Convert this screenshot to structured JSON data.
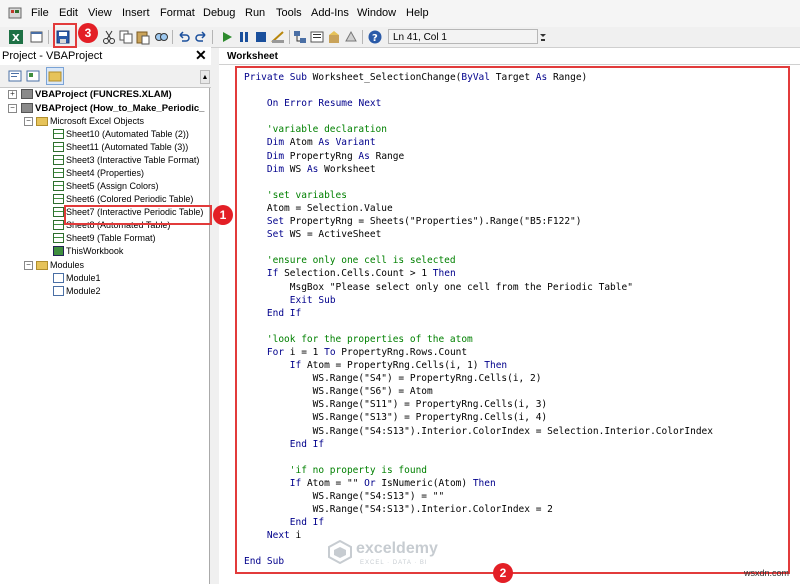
{
  "menubar": {
    "items": [
      "File",
      "Edit",
      "View",
      "Insert",
      "Format",
      "Debug",
      "Run",
      "Tools",
      "Add-Ins",
      "Window",
      "Help"
    ]
  },
  "toolbar": {
    "position": "Ln 41, Col 1",
    "icons": [
      "excel-icon",
      "insert-userform-icon",
      "save-icon",
      "cut-icon",
      "copy-icon",
      "paste-icon",
      "find-icon",
      "undo-icon",
      "redo-icon",
      "run-icon",
      "break-icon",
      "reset-icon",
      "design-mode-icon",
      "project-explorer-icon",
      "properties-icon",
      "object-browser-icon",
      "toolbox-icon",
      "help-icon"
    ]
  },
  "project_pane": {
    "title": "Project - VBAProject",
    "tree": [
      {
        "label": "VBAProject (FUNCRES.XLAM)",
        "kind": "project",
        "level": 0
      },
      {
        "label": "VBAProject (How_to_Make_Periodic_",
        "kind": "project",
        "level": 0
      },
      {
        "label": "Microsoft Excel Objects",
        "kind": "folder",
        "level": 1
      },
      {
        "label": "Sheet10 (Automated Table (2))",
        "kind": "sheet",
        "level": 2
      },
      {
        "label": "Sheet11 (Automated Table (3))",
        "kind": "sheet",
        "level": 2
      },
      {
        "label": "Sheet3 (Interactive Table Format)",
        "kind": "sheet",
        "level": 2
      },
      {
        "label": "Sheet4 (Properties)",
        "kind": "sheet",
        "level": 2
      },
      {
        "label": "Sheet5 (Assign Colors)",
        "kind": "sheet",
        "level": 2
      },
      {
        "label": "Sheet6 (Colored Periodic Table)",
        "kind": "sheet",
        "level": 2
      },
      {
        "label": "Sheet7 (Interactive Periodic Table)",
        "kind": "sheet",
        "level": 2
      },
      {
        "label": "Sheet8 (Automated Table)",
        "kind": "sheet",
        "level": 2
      },
      {
        "label": "Sheet9 (Table Format)",
        "kind": "sheet",
        "level": 2
      },
      {
        "label": "ThisWorkbook",
        "kind": "workbook",
        "level": 2
      },
      {
        "label": "Modules",
        "kind": "folder",
        "level": 1
      },
      {
        "label": "Module1",
        "kind": "module",
        "level": 2
      },
      {
        "label": "Module2",
        "kind": "module",
        "level": 2
      }
    ]
  },
  "code_window": {
    "object": "Worksheet",
    "lines": [
      "Private Sub Worksheet_SelectionChange(ByVal Target As Range)",
      "",
      "    On Error Resume Next",
      "",
      "    'variable declaration",
      "    Dim Atom As Variant",
      "    Dim PropertyRng As Range",
      "    Dim WS As Worksheet",
      "",
      "    'set variables",
      "    Atom = Selection.Value",
      "    Set PropertyRng = Sheets(\"Properties\").Range(\"B5:F122\")",
      "    Set WS = ActiveSheet",
      "",
      "    'ensure only one cell is selected",
      "    If Selection.Cells.Count > 1 Then",
      "        MsgBox \"Please select only one cell from the Periodic Table\"",
      "        Exit Sub",
      "    End If",
      "",
      "    'look for the properties of the atom",
      "    For i = 1 To PropertyRng.Rows.Count",
      "        If Atom = PropertyRng.Cells(i, 1) Then",
      "            WS.Range(\"S4\") = PropertyRng.Cells(i, 2)",
      "            WS.Range(\"S6\") = Atom",
      "            WS.Range(\"S11\") = PropertyRng.Cells(i, 3)",
      "            WS.Range(\"S13\") = PropertyRng.Cells(i, 4)",
      "            WS.Range(\"S4:S13\").Interior.ColorIndex = Selection.Interior.ColorIndex",
      "        End If",
      "",
      "        'if no property is found",
      "        If Atom = \"\" Or IsNumeric(Atom) Then",
      "            WS.Range(\"S4:S13\") = \"\"",
      "            WS.Range(\"S4:S13\").Interior.ColorIndex = 2",
      "        End If",
      "    Next i",
      "",
      "End Sub"
    ]
  },
  "annotations": {
    "badge1": "1",
    "badge2": "2",
    "badge3": "3",
    "color": "#e31f26"
  },
  "watermark": {
    "name": "exceldemy",
    "tagline": "EXCEL · DATA · BI"
  },
  "site": "wsxdn.com"
}
